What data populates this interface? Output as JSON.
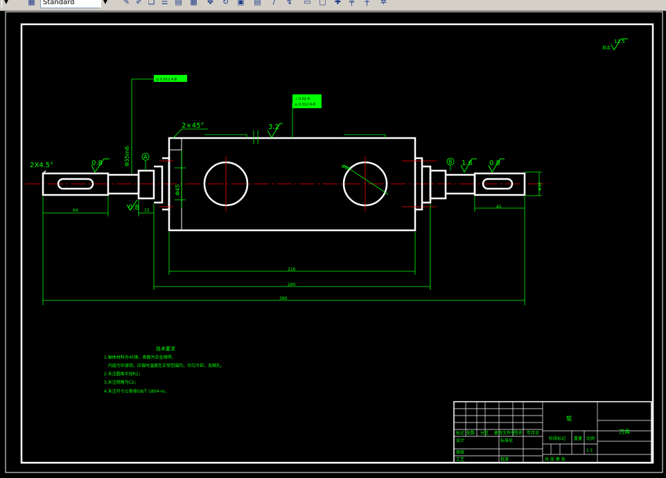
{
  "toolbar": {
    "style_dropdown": "Standard",
    "icons": [
      "style-icon",
      "pencil-icon",
      "paint-icon",
      "layer-icon",
      "grid-icon",
      "move-icon",
      "rotate-icon",
      "box-icon",
      "document-icon",
      "line-icon",
      "measure-icon",
      "rectangle-icon",
      "window-icon",
      "snap-icon",
      "cross-icon",
      "pin-icon",
      "properties-icon"
    ]
  },
  "drawing": {
    "roughness_symbol": "12.5",
    "roughness_prefix": "其余",
    "chamfer_left_end": "2X4.5°",
    "chamfer_body": "2×45°",
    "roughness_left_journal": "0.8",
    "roughness_body": "3.2",
    "roughness_right_journal": "1.6",
    "roughness_right_end": "0.8",
    "roughness_shoulder": "0.8",
    "datum_a": "A",
    "datum_b": "B",
    "tolerance_frame_1": "◎ 0.012 A-B",
    "tolerance_frame_2a": "⊥ 0.02 A",
    "tolerance_frame_2b": "◎ 0.012 A-B",
    "diameter_left": "Φ35m6",
    "diameter_body": "Φ45",
    "hole_label": "Φ60",
    "dim_keyway_left": "64",
    "dim_shoulder": "15",
    "dim_keyway_right": "45",
    "dim_body": "216",
    "dim_mid": "260",
    "dim_total": "390",
    "right_diameter": "Φ30"
  },
  "notes": {
    "title": "技术要求",
    "lines": [
      "1.轴体材料为45钢，表面为合金钢焊。",
      "内层为灰铸铁，压铸时温度在正常范围内，均匀冷却，无缩孔。",
      "2.未注圆角半径R2；",
      "3.未注倒角为C2；",
      "4.未注尺寸公差按GB/T 1804-m。"
    ]
  },
  "title_block": {
    "part_name": "辊",
    "company": "刀具",
    "scale_label": "比例",
    "weight_label": "重量",
    "stage_label": "阶段标记",
    "scale_value": "1:1",
    "sheet_label": "共  张  第  张",
    "design_label": "设计",
    "check_label": "审核",
    "process_label": "工艺",
    "approve_label": "批准",
    "mark_label": "标记",
    "count_label": "处数",
    "zone_label": "分区",
    "doc_label": "更改文件号",
    "sign_label": "签名",
    "date_label": "年月日",
    "std_label": "标准化"
  },
  "colors": {
    "background": "#000000",
    "line": "#ffffff",
    "dimension": "#00ff00",
    "centerline": "#ff0000",
    "frame_highlight": "#00ff00"
  }
}
